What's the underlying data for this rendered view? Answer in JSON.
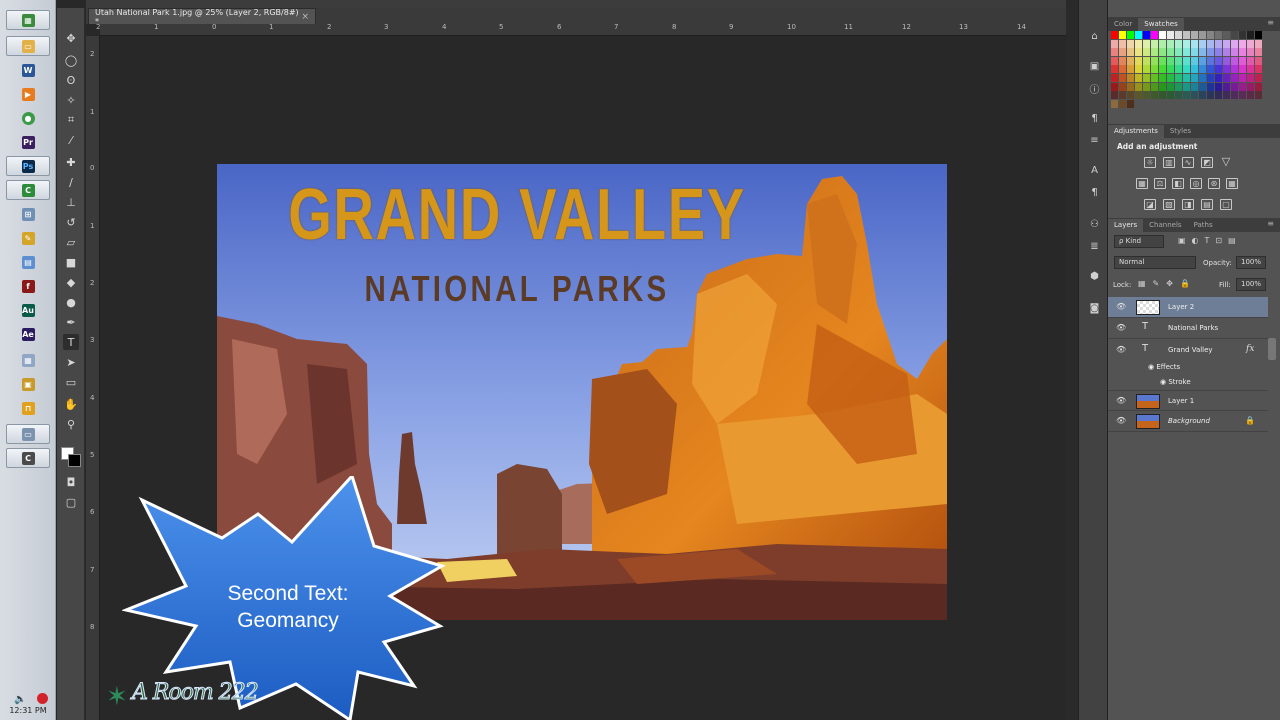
{
  "document": {
    "tab_title": "Utah National Park 1.jpg @ 25% (Layer 2, RGB/8#) *",
    "tab_close": "×"
  },
  "artwork": {
    "title": "GRAND VALLEY",
    "subtitle": "NATIONAL PARKS"
  },
  "overlay": {
    "line1": "Second Text:",
    "line2": "Geomancy",
    "watermark": "A Room 222"
  },
  "rulers": {
    "horizontal": [
      "2",
      "1",
      "0",
      "1",
      "2",
      "3",
      "4",
      "5",
      "6",
      "7",
      "8",
      "9",
      "10",
      "11",
      "12",
      "13",
      "14"
    ],
    "vertical": [
      "2",
      "1",
      "0",
      "1",
      "2",
      "3",
      "4",
      "5",
      "6",
      "7",
      "8"
    ]
  },
  "taskbar": {
    "clock": "12:31 PM"
  },
  "panels": {
    "color_tabs": [
      "Color",
      "Swatches"
    ],
    "adjust_tabs": [
      "Adjustments",
      "Styles"
    ],
    "adjust_title": "Add an adjustment",
    "layer_tabs": [
      "Layers",
      "Channels",
      "Paths"
    ],
    "kind_filter": "ρ Kind",
    "blend_mode": "Normal",
    "opacity_label": "Opacity:",
    "opacity_value": "100%",
    "locks_label": "Lock:",
    "fill_label": "Fill:",
    "fill_value": "100%",
    "layers": [
      {
        "name": "Layer 2",
        "kind": "pixel-empty",
        "selected": true
      },
      {
        "name": "National Parks",
        "kind": "text"
      },
      {
        "name": "Grand Valley",
        "kind": "text",
        "fx": "fx"
      },
      {
        "name": "Layer 1",
        "kind": "image"
      },
      {
        "name": "Background",
        "kind": "image",
        "locked": true
      }
    ],
    "effects_label": "Effects",
    "stroke_label": "Stroke"
  },
  "colors": {
    "selection": "#6e7e96",
    "title_gold": "#d5961a",
    "subtitle_brown": "#5b3b26",
    "star_blue": "#2a72d9"
  }
}
